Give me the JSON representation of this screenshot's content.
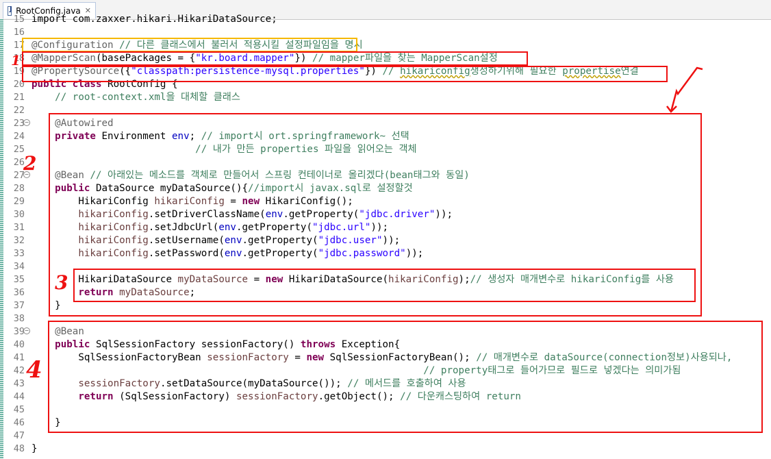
{
  "tab": {
    "filename": "RootConfig.java",
    "close": "✕"
  },
  "lines": [
    {
      "n": "15",
      "fold": false,
      "t": [
        [
          "pl",
          "import com.zaxxer.hikari.HikariDataSource;"
        ]
      ]
    },
    {
      "n": "16",
      "fold": false,
      "t": []
    },
    {
      "n": "17",
      "fold": false,
      "t": [
        [
          "ann",
          "@Configuration"
        ],
        [
          "pl",
          " "
        ],
        [
          "cm",
          "// 다른 클래스에서 불러서 적용시킬 설정파일임을 명시"
        ]
      ]
    },
    {
      "n": "18",
      "fold": false,
      "t": [
        [
          "ann",
          "@MapperScan"
        ],
        [
          "pl",
          "(basePackages = {"
        ],
        [
          "str",
          "\"kr.board.mapper\""
        ],
        [
          "pl",
          "}) "
        ],
        [
          "cm",
          "// mapper파일을 찾는 MapperScan설정"
        ]
      ]
    },
    {
      "n": "19",
      "fold": false,
      "t": [
        [
          "ann",
          "@PropertySource"
        ],
        [
          "pl",
          "({"
        ],
        [
          "str",
          "\"classpath:persistence-mysql.properties\""
        ],
        [
          "pl",
          "}) "
        ],
        [
          "cm",
          "// "
        ],
        [
          "cm sq",
          "hikariconfig"
        ],
        [
          "cm",
          "생성하기위해 필요한 "
        ],
        [
          "cm sq",
          "propertise"
        ],
        [
          "cm",
          "연결"
        ]
      ]
    },
    {
      "n": "20",
      "fold": false,
      "t": [
        [
          "kw",
          "public class"
        ],
        [
          "pl",
          " RootConfig {"
        ]
      ]
    },
    {
      "n": "21",
      "fold": false,
      "t": [
        [
          "pl",
          "    "
        ],
        [
          "cm",
          "// root-context.xml을 대체할 클래스"
        ]
      ]
    },
    {
      "n": "22",
      "fold": false,
      "t": []
    },
    {
      "n": "23",
      "fold": true,
      "t": [
        [
          "pl",
          "    "
        ],
        [
          "ann",
          "@Autowired"
        ]
      ]
    },
    {
      "n": "24",
      "fold": false,
      "t": [
        [
          "pl",
          "    "
        ],
        [
          "kw",
          "private"
        ],
        [
          "pl",
          " Environment "
        ],
        [
          "fld",
          "env"
        ],
        [
          "pl",
          "; "
        ],
        [
          "cm",
          "// import시 ort.springframework~ 선택"
        ]
      ]
    },
    {
      "n": "25",
      "fold": false,
      "t": [
        [
          "pl",
          "                            "
        ],
        [
          "cm",
          "// 내가 만든 properties 파일을 읽어오는 객체"
        ]
      ]
    },
    {
      "n": "26",
      "fold": false,
      "t": []
    },
    {
      "n": "27",
      "fold": true,
      "t": [
        [
          "pl",
          "    "
        ],
        [
          "ann",
          "@Bean"
        ],
        [
          "pl",
          " "
        ],
        [
          "cm",
          "// 아래있는 메소드를 객체로 만들어서 스프링 컨테이너로 올리겠다(bean태그와 동일)"
        ]
      ]
    },
    {
      "n": "28",
      "fold": false,
      "t": [
        [
          "pl",
          "    "
        ],
        [
          "kw",
          "public"
        ],
        [
          "pl",
          " DataSource myDataSource(){"
        ],
        [
          "cm",
          "//import시 javax.sql로 설정할것"
        ]
      ]
    },
    {
      "n": "29",
      "fold": false,
      "t": [
        [
          "pl",
          "        HikariConfig "
        ],
        [
          "var",
          "hikariConfig"
        ],
        [
          "pl",
          " = "
        ],
        [
          "kw",
          "new"
        ],
        [
          "pl",
          " HikariConfig();"
        ]
      ]
    },
    {
      "n": "30",
      "fold": false,
      "t": [
        [
          "pl",
          "        "
        ],
        [
          "var",
          "hikariConfig"
        ],
        [
          "pl",
          ".setDriverClassName("
        ],
        [
          "fld",
          "env"
        ],
        [
          "pl",
          ".getProperty("
        ],
        [
          "str",
          "\"jdbc.driver\""
        ],
        [
          "pl",
          "));"
        ]
      ]
    },
    {
      "n": "31",
      "fold": false,
      "t": [
        [
          "pl",
          "        "
        ],
        [
          "var",
          "hikariConfig"
        ],
        [
          "pl",
          ".setJdbcUrl("
        ],
        [
          "fld",
          "env"
        ],
        [
          "pl",
          ".getProperty("
        ],
        [
          "str",
          "\"jdbc.url\""
        ],
        [
          "pl",
          "));"
        ]
      ]
    },
    {
      "n": "32",
      "fold": false,
      "t": [
        [
          "pl",
          "        "
        ],
        [
          "var",
          "hikariConfig"
        ],
        [
          "pl",
          ".setUsername("
        ],
        [
          "fld",
          "env"
        ],
        [
          "pl",
          ".getProperty("
        ],
        [
          "str",
          "\"jdbc.user\""
        ],
        [
          "pl",
          "));"
        ]
      ]
    },
    {
      "n": "33",
      "fold": false,
      "t": [
        [
          "pl",
          "        "
        ],
        [
          "var",
          "hikariConfig"
        ],
        [
          "pl",
          ".setPassword("
        ],
        [
          "fld",
          "env"
        ],
        [
          "pl",
          ".getProperty("
        ],
        [
          "str",
          "\"jdbc.password\""
        ],
        [
          "pl",
          "));"
        ]
      ]
    },
    {
      "n": "34",
      "fold": false,
      "t": []
    },
    {
      "n": "35",
      "fold": false,
      "t": [
        [
          "pl",
          "        HikariDataSource "
        ],
        [
          "var",
          "myDataSource"
        ],
        [
          "pl",
          " = "
        ],
        [
          "kw",
          "new"
        ],
        [
          "pl",
          " HikariDataSource("
        ],
        [
          "var",
          "hikariConfig"
        ],
        [
          "pl",
          ");"
        ],
        [
          "cm",
          "// 생성자 매개변수로 hikariConfig를 사용"
        ]
      ]
    },
    {
      "n": "36",
      "fold": false,
      "t": [
        [
          "pl",
          "        "
        ],
        [
          "kw",
          "return"
        ],
        [
          "pl",
          " "
        ],
        [
          "var",
          "myDataSource"
        ],
        [
          "pl",
          ";"
        ]
      ]
    },
    {
      "n": "37",
      "fold": false,
      "t": [
        [
          "pl",
          "    }"
        ]
      ]
    },
    {
      "n": "38",
      "fold": false,
      "t": []
    },
    {
      "n": "39",
      "fold": true,
      "t": [
        [
          "pl",
          "    "
        ],
        [
          "ann",
          "@Bean"
        ]
      ]
    },
    {
      "n": "40",
      "fold": false,
      "t": [
        [
          "pl",
          "    "
        ],
        [
          "kw",
          "public"
        ],
        [
          "pl",
          " SqlSessionFactory sessionFactory() "
        ],
        [
          "kw",
          "throws"
        ],
        [
          "pl",
          " Exception{"
        ]
      ]
    },
    {
      "n": "41",
      "fold": false,
      "t": [
        [
          "pl",
          "        SqlSessionFactoryBean "
        ],
        [
          "var",
          "sessionFactory"
        ],
        [
          "pl",
          " = "
        ],
        [
          "kw",
          "new"
        ],
        [
          "pl",
          " SqlSessionFactoryBean(); "
        ],
        [
          "cm",
          "// 매개변수로 dataSource(connection정보)사용되나,"
        ]
      ]
    },
    {
      "n": "42",
      "fold": false,
      "t": [
        [
          "pl",
          "                                                                   "
        ],
        [
          "cm",
          "// property태그로 들어가므로 필드로 넣겠다는 의미가됨"
        ]
      ]
    },
    {
      "n": "43",
      "fold": false,
      "t": [
        [
          "pl",
          "        "
        ],
        [
          "var",
          "sessionFactory"
        ],
        [
          "pl",
          ".setDataSource(myDataSource()); "
        ],
        [
          "cm",
          "// 메서드를 호출하여 사용"
        ]
      ]
    },
    {
      "n": "44",
      "fold": false,
      "t": [
        [
          "pl",
          "        "
        ],
        [
          "kw",
          "return"
        ],
        [
          "pl",
          " (SqlSessionFactory) "
        ],
        [
          "var",
          "sessionFactory"
        ],
        [
          "pl",
          ".getObject(); "
        ],
        [
          "cm",
          "// 다운캐스팅하여 return"
        ]
      ]
    },
    {
      "n": "45",
      "fold": false,
      "t": []
    },
    {
      "n": "46",
      "fold": false,
      "t": [
        [
          "pl",
          "    }"
        ]
      ]
    },
    {
      "n": "47",
      "fold": false,
      "t": []
    },
    {
      "n": "48",
      "fold": false,
      "t": [
        [
          "pl",
          "}"
        ]
      ]
    }
  ],
  "markers": {
    "m1": "1",
    "m2": "2",
    "m3": "3",
    "m4": "4"
  }
}
